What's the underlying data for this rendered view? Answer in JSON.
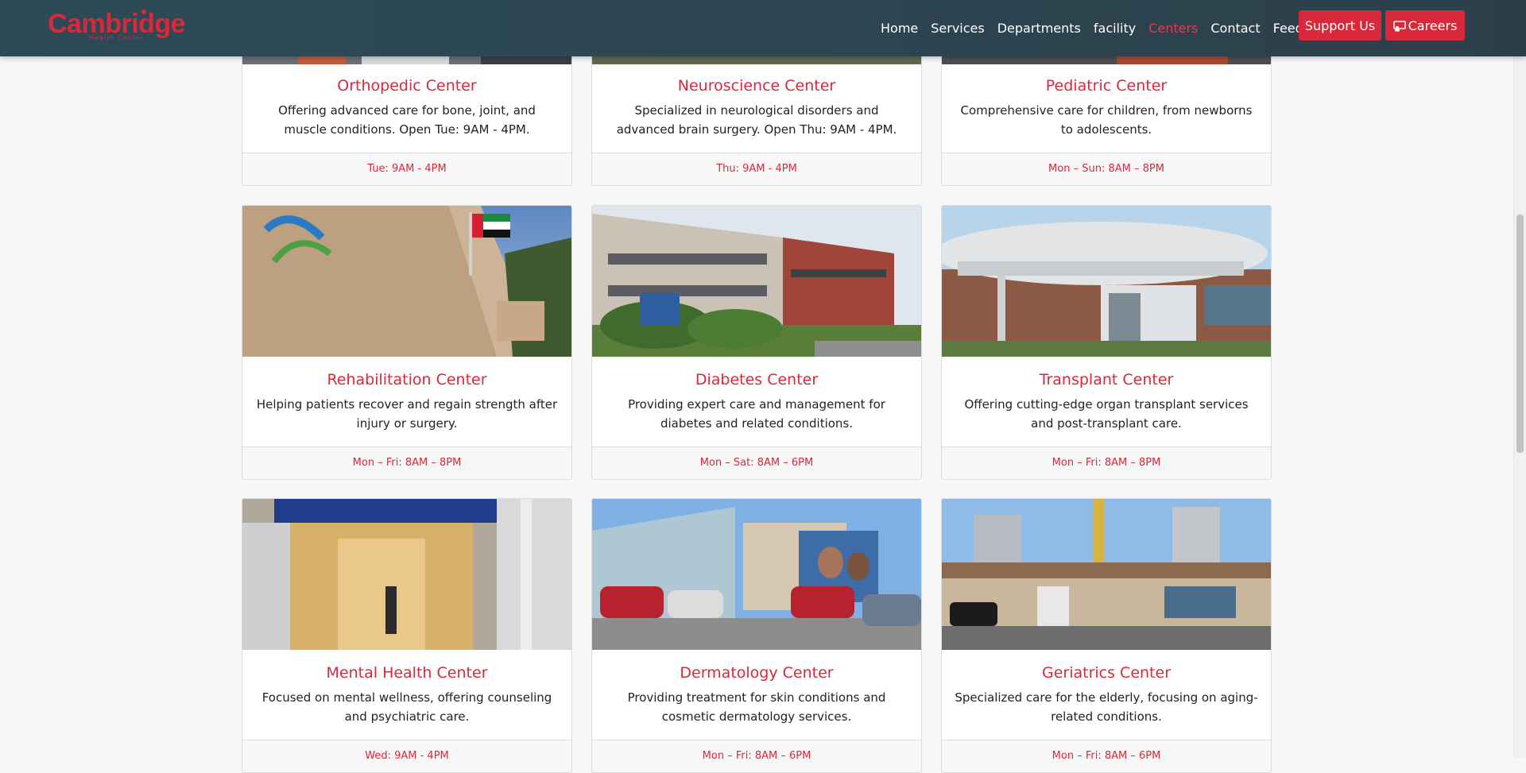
{
  "header": {
    "logo_text": "Cambridge",
    "logo_sub": "Health Center",
    "nav": [
      {
        "label": "Home"
      },
      {
        "label": "Services"
      },
      {
        "label": "Departments"
      },
      {
        "label": "facility"
      },
      {
        "label": "Centers",
        "active": true
      },
      {
        "label": "Contact"
      },
      {
        "label": "Feedback"
      }
    ],
    "support_label": "Support Us",
    "careers_label": "Careers",
    "accent_color": "#d8283a"
  },
  "cards": [
    {
      "title": "Orthopedic Center",
      "desc": "Offering advanced care for bone, joint, and muscle conditions. Open Tue: 9AM - 4PM.",
      "hours": "Tue: 9AM - 4PM"
    },
    {
      "title": "Neuroscience Center",
      "desc": "Specialized in neurological disorders and advanced brain surgery. Open Thu: 9AM - 4PM.",
      "hours": "Thu: 9AM - 4PM"
    },
    {
      "title": "Pediatric Center",
      "desc": "Comprehensive care for children, from newborns to adolescents.",
      "hours": "Mon – Sun: 8AM – 8PM"
    },
    {
      "title": "Rehabilitation Center",
      "desc": "Helping patients recover and regain strength after injury or surgery.",
      "hours": "Mon – Fri: 8AM – 8PM"
    },
    {
      "title": "Diabetes Center",
      "desc": "Providing expert care and management for diabetes and related conditions.",
      "hours": "Mon – Sat: 8AM – 6PM"
    },
    {
      "title": "Transplant Center",
      "desc": "Offering cutting-edge organ transplant services and post-transplant care.",
      "hours": "Mon – Fri: 8AM – 8PM"
    },
    {
      "title": "Mental Health Center",
      "desc": "Focused on mental wellness, offering counseling and psychiatric care.",
      "hours": "Wed: 9AM - 4PM"
    },
    {
      "title": "Dermatology Center",
      "desc": "Providing treatment for skin conditions and cosmetic dermatology services.",
      "hours": "Mon – Fri: 8AM – 6PM"
    },
    {
      "title": "Geriatrics Center",
      "desc": "Specialized care for the elderly, focusing on aging-related conditions.",
      "hours": "Mon – Fri: 8AM – 6PM"
    }
  ]
}
